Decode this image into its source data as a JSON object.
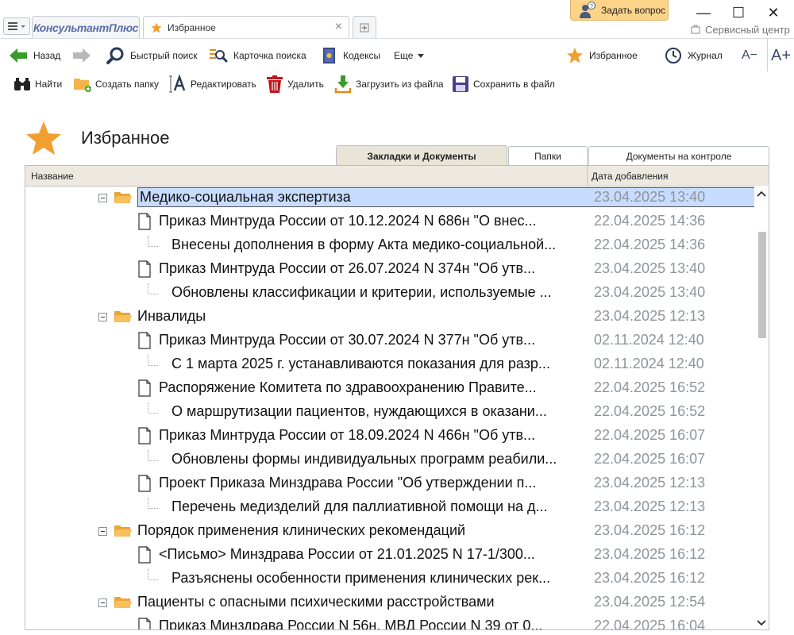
{
  "titlebar": {
    "logo": "КонсультантПлюс",
    "active_tab": "Избранное",
    "ask_button": "Задать вопрос",
    "service_center": "Сервисный центр"
  },
  "toolbar": {
    "back": "Назад",
    "quick_search": "Быстрый поиск",
    "search_card": "Карточка поиска",
    "codes": "Кодексы",
    "more": "Еще",
    "favorites": "Избранное",
    "journal": "Журнал",
    "font_decrease": "A−",
    "font_increase": "A+"
  },
  "actions": {
    "find": "Найти",
    "create_folder": "Создать папку",
    "edit": "Редактировать",
    "delete": "Удалить",
    "load_from_file": "Загрузить из файла",
    "save_to_file": "Сохранить в файл"
  },
  "page": {
    "title": "Избранное"
  },
  "view_tabs": [
    "Закладки и Документы",
    "Папки",
    "Документы на контроле"
  ],
  "grid": {
    "col_name": "Название",
    "col_date": "Дата добавления",
    "rows": [
      {
        "type": "folder",
        "label": "Медико-социальная экспертиза",
        "date": "23.04.2025 13:40",
        "selected": true
      },
      {
        "type": "doc",
        "label": "Приказ Минтруда России от 10.12.2024 N 686н \"О внес...",
        "date": "22.04.2025 14:36"
      },
      {
        "type": "note",
        "label": "Внесены дополнения в форму Акта медико-социальной...",
        "date": "22.04.2025 14:36"
      },
      {
        "type": "doc",
        "label": "Приказ Минтруда России от 26.07.2024 N 374н \"Об утв...",
        "date": "23.04.2025 13:40"
      },
      {
        "type": "note",
        "label": "Обновлены классификации и критерии, используемые ...",
        "date": "23.04.2025 13:40"
      },
      {
        "type": "folder",
        "label": "Инвалиды",
        "date": "23.04.2025 12:13"
      },
      {
        "type": "doc",
        "label": "Приказ Минтруда России от 30.07.2024 N 377н \"Об утв...",
        "date": "02.11.2024 12:40"
      },
      {
        "type": "note",
        "label": "С 1 марта 2025 г. устанавливаются показания для разр...",
        "date": "02.11.2024 12:40"
      },
      {
        "type": "doc",
        "label": "Распоряжение Комитета по здравоохранению Правите...",
        "date": "22.04.2025 16:52"
      },
      {
        "type": "note",
        "label": "О маршрутизации пациентов, нуждающихся в оказани...",
        "date": "22.04.2025 16:52"
      },
      {
        "type": "doc",
        "label": "Приказ Минтруда России от 18.09.2024 N 466н \"Об утв...",
        "date": "22.04.2025 16:07"
      },
      {
        "type": "note",
        "label": "Обновлены формы индивидуальных программ реабили...",
        "date": "22.04.2025 16:07"
      },
      {
        "type": "doc",
        "label": "Проект Приказа Минздрава России \"Об утверждении п...",
        "date": "23.04.2025 12:13"
      },
      {
        "type": "note",
        "label": "Перечень медизделий для паллиативной помощи на д...",
        "date": "23.04.2025 12:13"
      },
      {
        "type": "folder",
        "label": "Порядок применения клинических рекомендаций",
        "date": "23.04.2025 16:12"
      },
      {
        "type": "doc",
        "label": "<Письмо> Минздрава России от 21.01.2025 N 17-1/300...",
        "date": "23.04.2025 16:12"
      },
      {
        "type": "note",
        "label": "Разъяснены особенности применения клинических рек...",
        "date": "23.04.2025 16:12"
      },
      {
        "type": "folder",
        "label": "Пациенты с опасными психическими расстройствами",
        "date": "23.04.2025 12:54"
      },
      {
        "type": "doc",
        "label": "Приказ Минздрава России N 56н, МВД России N 39 от 0...",
        "date": "22.04.2025 16:04"
      }
    ]
  },
  "colors": {
    "accent_star": "#f0a030",
    "back_arrow": "#3a9a2c",
    "selection": "#c8dcff",
    "ask_button": "#fbd389",
    "date_text": "#8f949a"
  }
}
